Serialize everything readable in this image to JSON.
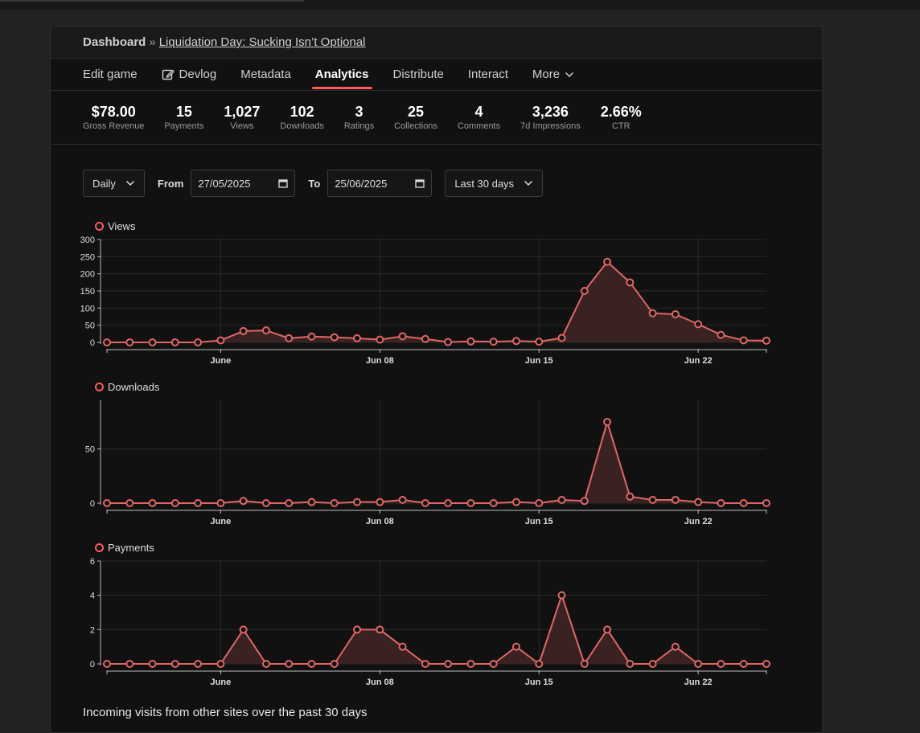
{
  "breadcrumb": {
    "root": "Dashboard",
    "separator": "»",
    "game_title": "Liquidation Day: Sucking Isn’t Optional"
  },
  "tabs": [
    {
      "label": "Edit game",
      "active": false,
      "icon": ""
    },
    {
      "label": "Devlog",
      "active": false,
      "icon": "edit-icon"
    },
    {
      "label": "Metadata",
      "active": false,
      "icon": ""
    },
    {
      "label": "Analytics",
      "active": true,
      "icon": ""
    },
    {
      "label": "Distribute",
      "active": false,
      "icon": ""
    },
    {
      "label": "Interact",
      "active": false,
      "icon": ""
    },
    {
      "label": "More",
      "active": false,
      "icon": "chevron-down-icon"
    }
  ],
  "stats": [
    {
      "value": "$78.00",
      "label": "Gross Revenue"
    },
    {
      "value": "15",
      "label": "Payments"
    },
    {
      "value": "1,027",
      "label": "Views"
    },
    {
      "value": "102",
      "label": "Downloads"
    },
    {
      "value": "3",
      "label": "Ratings"
    },
    {
      "value": "25",
      "label": "Collections"
    },
    {
      "value": "4",
      "label": "Comments"
    },
    {
      "value": "3,236",
      "label": "7d Impressions"
    },
    {
      "value": "2.66%",
      "label": "CTR"
    }
  ],
  "filters": {
    "interval": "Daily",
    "from_label": "From",
    "from_date": "27/05/2025",
    "to_label": "To",
    "to_date": "25/06/2025",
    "range": "Last 30 days"
  },
  "colors": {
    "accent": "#fa5c5c",
    "series": "#e06666",
    "area": "#3a2222",
    "panel": "#111111"
  },
  "chart_data": [
    {
      "type": "area",
      "title": "Views",
      "x": [
        "2025-05-27",
        "2025-05-28",
        "2025-05-29",
        "2025-05-30",
        "2025-05-31",
        "2025-06-01",
        "2025-06-02",
        "2025-06-03",
        "2025-06-04",
        "2025-06-05",
        "2025-06-06",
        "2025-06-07",
        "2025-06-08",
        "2025-06-09",
        "2025-06-10",
        "2025-06-11",
        "2025-06-12",
        "2025-06-13",
        "2025-06-14",
        "2025-06-15",
        "2025-06-16",
        "2025-06-17",
        "2025-06-18",
        "2025-06-19",
        "2025-06-20",
        "2025-06-21",
        "2025-06-22",
        "2025-06-23",
        "2025-06-24",
        "2025-06-25"
      ],
      "values": [
        0,
        0,
        0,
        0,
        0,
        6,
        33,
        35,
        12,
        17,
        15,
        12,
        8,
        18,
        10,
        1,
        3,
        2,
        4,
        2,
        13,
        150,
        235,
        175,
        85,
        82,
        53,
        22,
        6,
        5
      ],
      "ylim": [
        0,
        300
      ],
      "yticks": [
        0,
        50,
        100,
        150,
        200,
        250,
        300
      ],
      "xticks": [
        {
          "label": "June",
          "date": "2025-06-01"
        },
        {
          "label": "Jun 08",
          "date": "2025-06-08"
        },
        {
          "label": "Jun 15",
          "date": "2025-06-15"
        },
        {
          "label": "Jun 22",
          "date": "2025-06-22"
        }
      ],
      "grid": true
    },
    {
      "type": "area",
      "title": "Downloads",
      "x": [
        "2025-05-27",
        "2025-05-28",
        "2025-05-29",
        "2025-05-30",
        "2025-05-31",
        "2025-06-01",
        "2025-06-02",
        "2025-06-03",
        "2025-06-04",
        "2025-06-05",
        "2025-06-06",
        "2025-06-07",
        "2025-06-08",
        "2025-06-09",
        "2025-06-10",
        "2025-06-11",
        "2025-06-12",
        "2025-06-13",
        "2025-06-14",
        "2025-06-15",
        "2025-06-16",
        "2025-06-17",
        "2025-06-18",
        "2025-06-19",
        "2025-06-20",
        "2025-06-21",
        "2025-06-22",
        "2025-06-23",
        "2025-06-24",
        "2025-06-25"
      ],
      "values": [
        0,
        0,
        0,
        0,
        0,
        0,
        2,
        0,
        0,
        1,
        0,
        1,
        1,
        3,
        0,
        0,
        0,
        0,
        1,
        0,
        3,
        2,
        75,
        6,
        3,
        3,
        1,
        0,
        0,
        0
      ],
      "ylim": [
        0,
        95
      ],
      "yticks": [
        0,
        50
      ],
      "xticks": [
        {
          "label": "June",
          "date": "2025-06-01"
        },
        {
          "label": "Jun 08",
          "date": "2025-06-08"
        },
        {
          "label": "Jun 15",
          "date": "2025-06-15"
        },
        {
          "label": "Jun 22",
          "date": "2025-06-22"
        }
      ],
      "grid": true
    },
    {
      "type": "area",
      "title": "Payments",
      "x": [
        "2025-05-27",
        "2025-05-28",
        "2025-05-29",
        "2025-05-30",
        "2025-05-31",
        "2025-06-01",
        "2025-06-02",
        "2025-06-03",
        "2025-06-04",
        "2025-06-05",
        "2025-06-06",
        "2025-06-07",
        "2025-06-08",
        "2025-06-09",
        "2025-06-10",
        "2025-06-11",
        "2025-06-12",
        "2025-06-13",
        "2025-06-14",
        "2025-06-15",
        "2025-06-16",
        "2025-06-17",
        "2025-06-18",
        "2025-06-19",
        "2025-06-20",
        "2025-06-21",
        "2025-06-22",
        "2025-06-23",
        "2025-06-24",
        "2025-06-25"
      ],
      "values": [
        0,
        0,
        0,
        0,
        0,
        0,
        2,
        0,
        0,
        0,
        0,
        2,
        2,
        1,
        0,
        0,
        0,
        0,
        1,
        0,
        4,
        0,
        2,
        0,
        0,
        1,
        0,
        0,
        0,
        0
      ],
      "ylim": [
        0,
        6
      ],
      "yticks": [
        0,
        2,
        4,
        6
      ],
      "xticks": [
        {
          "label": "June",
          "date": "2025-06-01"
        },
        {
          "label": "Jun 08",
          "date": "2025-06-08"
        },
        {
          "label": "Jun 15",
          "date": "2025-06-15"
        },
        {
          "label": "Jun 22",
          "date": "2025-06-22"
        }
      ],
      "grid": true
    }
  ],
  "footer": {
    "referrers_heading": "Incoming visits from other sites over the past 30 days"
  }
}
